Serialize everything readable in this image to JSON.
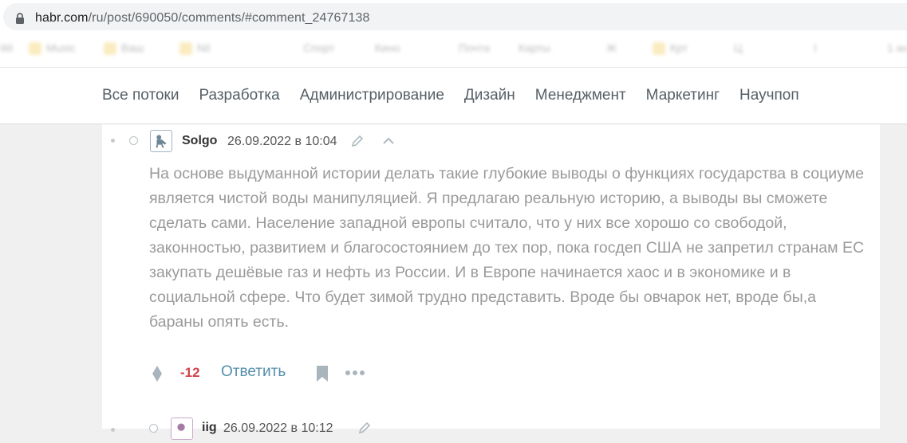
{
  "browser": {
    "url_host": "habr.com",
    "url_path": "/ru/post/690050/comments/#comment_24767138",
    "bookmarks": [
      "Wi",
      "Music",
      "Ваш",
      "Nil",
      "Спорт",
      "Кино",
      "Почта",
      "Карты",
      "Ж",
      "Крт",
      "Ц",
      "I",
      "1 ан"
    ]
  },
  "nav": {
    "items": [
      "Все потоки",
      "Разработка",
      "Администрирование",
      "Дизайн",
      "Менеджмент",
      "Маркетинг",
      "Научпоп"
    ]
  },
  "comment": {
    "author": "Solgo",
    "datetime": "26.09.2022 в 10:04",
    "paragraph": "На основе выдуманной истории делать такие глубокие выводы о функциях государства в социуме является чистой воды манипуляцией. Я предлагаю реальную историю, а выводы вы сможете сделать сами. Население западной европы считало, что у них все хорошо со свободой, законностью, развитием и благосостоянием до тех пор, пока госдеп США не запретил странам ЕС закупать дешёвые газ и нефть из России. И в Европе начинается хаос и в экономике и в социальной сфере. Что будет зимой трудно представить. Вроде бы овчарок нет, вроде бы,а бараны опять есть.",
    "score": "-12",
    "reply_label": "Ответить"
  },
  "next_comment": {
    "author": "iig",
    "datetime": "26.09.2022 в 10:12"
  },
  "colors": {
    "score_negative": "#d0454c",
    "reply_link": "#548eaa",
    "comment_text": "#9a9a9a"
  }
}
